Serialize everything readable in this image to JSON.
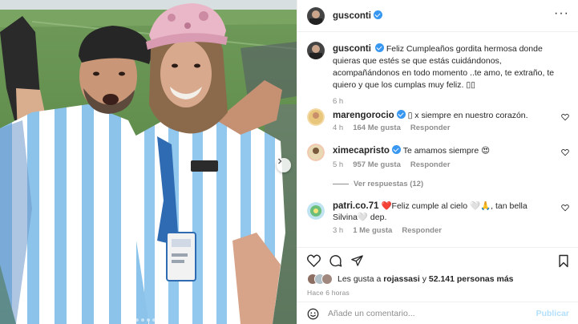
{
  "post": {
    "author": "gusconti",
    "caption": "Feliz Cumpleaños gordita hermosa donde quieras que estés se que estás cuidándonos, acompañándonos en todo momento ..te amo, te extraño, te quiero y que los cumplas muy feliz. ▯▯",
    "caption_age": "6 h",
    "likes_prefix": "Les gusta a",
    "likes_user": "rojassasi",
    "likes_conjunction": "y",
    "likes_count": "52.141 personas más",
    "timestamp": "Hace 6 horas",
    "carousel_slides": 7,
    "carousel_active_index": 0
  },
  "header": {
    "more_icon": "more-horizontal-icon"
  },
  "comments": [
    {
      "username": "marengorocio",
      "verified": true,
      "text": "▯ x siempre en nuestro corazón.",
      "age": "4 h",
      "likes": "164 Me gusta",
      "reply": "Responder"
    },
    {
      "username": "ximecapristo",
      "verified": true,
      "text": "Te amamos siempre 😍",
      "age": "5 h",
      "likes": "957 Me gusta",
      "reply": "Responder",
      "view_replies": "Ver respuestas (12)"
    },
    {
      "username": "patri.co.71",
      "verified": false,
      "text": "❤️Feliz cumple al cielo 🤍🙏, tan bella Silvina🤍 dep.",
      "age": "3 h",
      "likes": "1 Me gusta",
      "reply": "Responder"
    }
  ],
  "composer": {
    "placeholder": "Añade un comentario...",
    "publish": "Publicar"
  },
  "colors": {
    "verified": "#3897f0",
    "publish_disabled": "#b2dffc",
    "secondary_text": "#8e8e8e",
    "divider": "#efefef"
  }
}
